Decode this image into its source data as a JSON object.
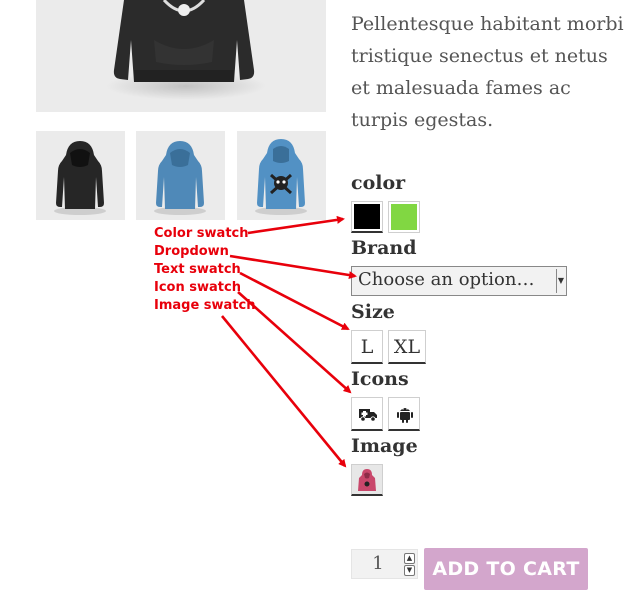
{
  "description": "Pellentesque habitant morbi tristique senectus et netus et malesuada fames ac turpis egestas.",
  "attributes": {
    "color_label": "color",
    "brand_label": "Brand",
    "size_label": "Size",
    "icons_label": "Icons",
    "image_label": "Image"
  },
  "colors": {
    "black": "#000000",
    "green": "#81d742"
  },
  "brand": {
    "selected": "Choose an option…"
  },
  "sizes": [
    "L",
    "XL"
  ],
  "icons": [
    "ambulance-icon",
    "android-icon"
  ],
  "quantity": "1",
  "add_to_cart_label": "ADD TO CART",
  "annotations": [
    "Color swatch",
    "Dropdown",
    "Text swatch",
    "Icon swatch",
    "Image swatch"
  ],
  "accent_colors": {
    "button": "#d3a6cc",
    "annotation": "#e8000b"
  }
}
